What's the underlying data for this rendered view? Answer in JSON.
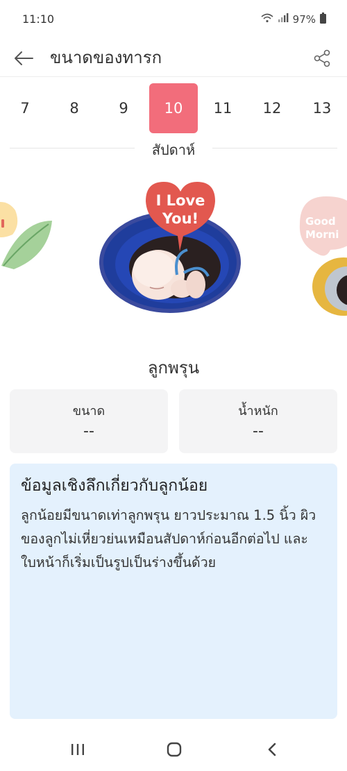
{
  "status": {
    "time": "11:10",
    "battery": "97%"
  },
  "header": {
    "title": "ขนาดของทารก"
  },
  "weeks": {
    "items": [
      "7",
      "8",
      "9",
      "10",
      "11",
      "12",
      "13"
    ],
    "selected": "10",
    "label": "สัปดาห์"
  },
  "carousel": {
    "bubble_line1": "I Love",
    "bubble_line2": "You!",
    "next_bubble_line1": "Good",
    "next_bubble_line2": "Morni"
  },
  "baby": {
    "fruit_name": "ลูกพรุน",
    "size_label": "ขนาด",
    "size_value": "--",
    "weight_label": "น้ำหนัก",
    "weight_value": "--"
  },
  "insight": {
    "title": "ข้อมูลเชิงลึกเกี่ยวกับลูกน้อย",
    "body": "ลูกน้อยมีขนาดเท่าลูกพรุน ยาวประมาณ 1.5 นิ้ว ผิวของลูกไม่เหี่ยวย่นเหมือนสัปดาห์ก่อนอีกต่อไป และใบหน้าก็เริ่มเป็นรูปเป็นร่างขึ้นด้วย"
  },
  "colors": {
    "accent": "#f26d7b",
    "insight_bg": "#e4f1fd",
    "card_bg": "#f4f4f5"
  }
}
